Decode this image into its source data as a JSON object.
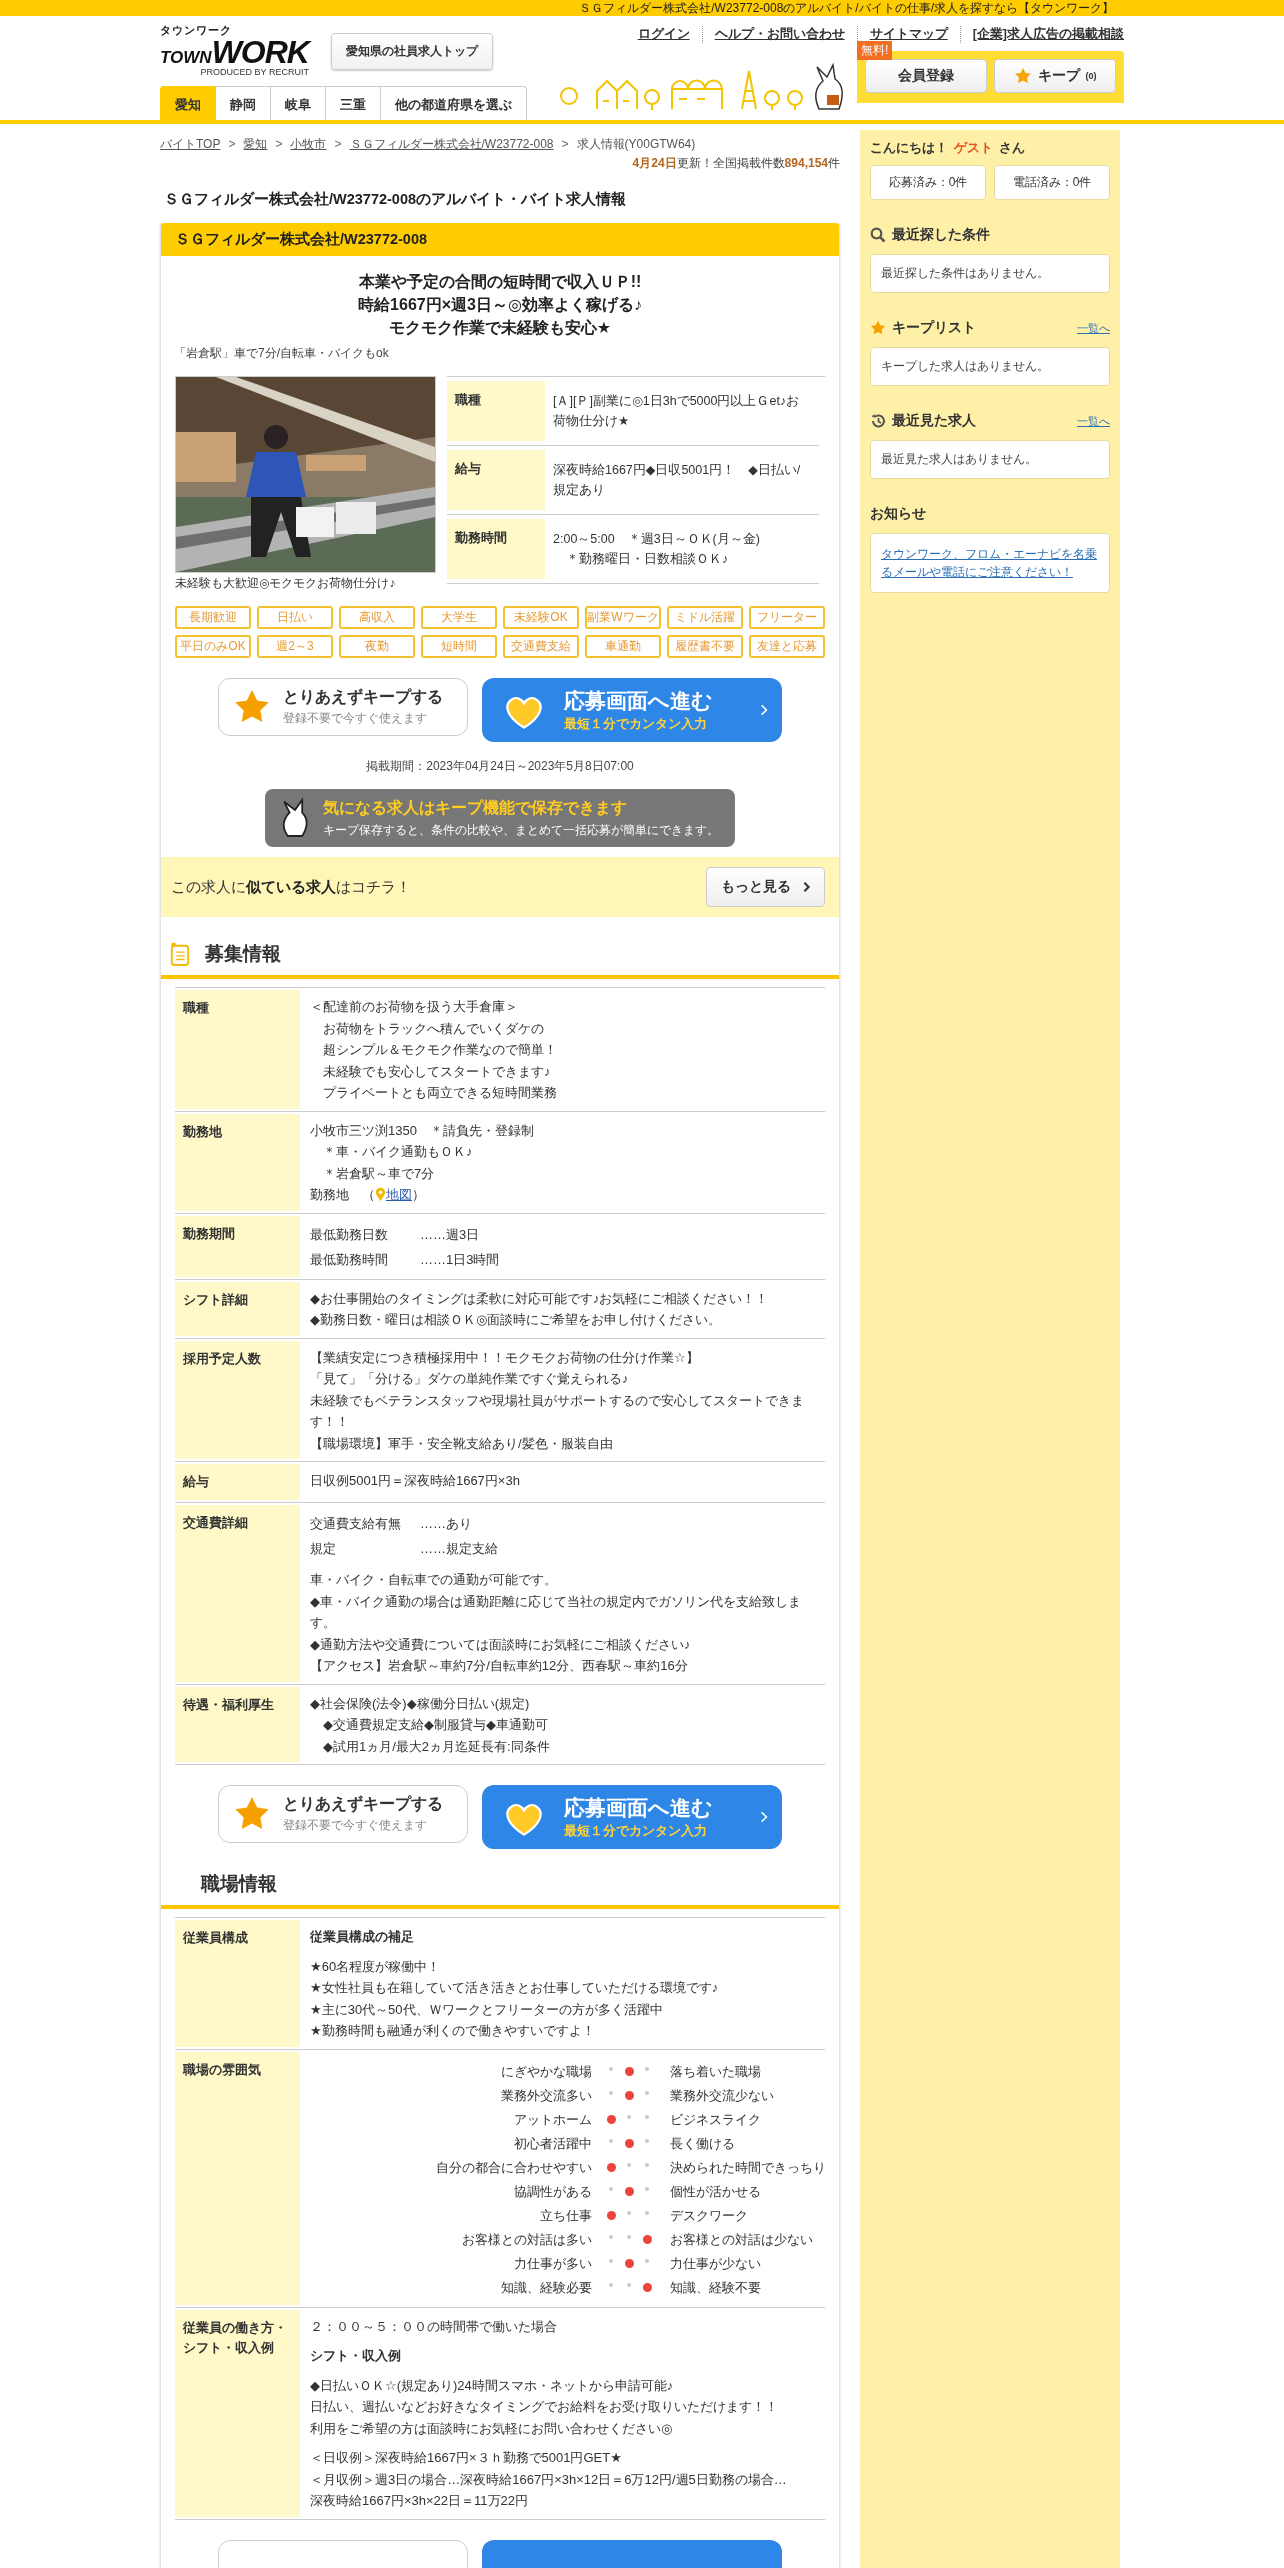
{
  "top_bar": {
    "text": "ＳＧフィルダー株式会社/W23772-008のアルバイト/バイトの仕事/求人を探すなら【タウンワーク】"
  },
  "header": {
    "logo": {
      "kana": "タウンワーク",
      "town": "TOWN",
      "work": "WORK",
      "sub": "PRODUCED BY RECRUIT"
    },
    "pref_top_button": "愛知県の社員求人トップ",
    "utility_links": [
      "ログイン",
      "ヘルプ・お問い合わせ",
      "サイトマップ",
      "[企業]求人広告の掲載相談"
    ],
    "pref_tabs": [
      {
        "label": "愛知",
        "selected": true
      },
      {
        "label": "静岡",
        "selected": false
      },
      {
        "label": "岐阜",
        "selected": false
      },
      {
        "label": "三重",
        "selected": false
      },
      {
        "label": "他の都道府県を選ぶ",
        "selected": false
      }
    ],
    "member_button": {
      "label": "会員登録",
      "badge": "無料!"
    },
    "keep_button": {
      "label": "キープ",
      "count": "(0)"
    }
  },
  "breadcrumb": [
    {
      "label": "バイトTOP",
      "link": true,
      "sep": ">"
    },
    {
      "label": "愛知",
      "link": true,
      "sep": ">"
    },
    {
      "label": "小牧市",
      "link": true,
      "sep": ">"
    },
    {
      "label": "ＳＧフィルダー株式会社/W23772-008",
      "link": true,
      "sep": ">"
    },
    {
      "label": "求人情報(Y00GTW64)",
      "link": false
    }
  ],
  "update": "**4月24日**更新！全国掲載件数**894,154**件",
  "page_title": "ＳＧフィルダー株式会社/W23772-008のアルバイト・バイト求人情報",
  "job": {
    "company": "ＳＧフィルダー株式会社/W23772-008",
    "catch": [
      "本業や予定の合間の短時間で収入ＵＰ!!",
      "時給1667円×週3日～◎効率よく稼げる♪",
      "モクモク作業で未経験も安心★"
    ],
    "access": "「岩倉駅」車で7分/自転車・バイクもok",
    "photo": {
      "kind": "picture",
      "caption": "未経験も大歓迎◎モクモクお荷物仕分け♪"
    },
    "summary": [
      {
        "label": "職種",
        "lines": [
          "[Ａ][Ｐ]副業に◎1日3hで5000円以上Ｇet♪お荷物仕分け★"
        ]
      },
      {
        "label": "給与",
        "lines": [
          "深夜時給1667円◆日収5001円！　◆日払い/規定あり"
        ]
      },
      {
        "label": "勤務時間",
        "lines": [
          "2:00～5:00　＊週3日～ＯＫ(月～金)",
          "　＊勤務曜日・日数相談ＯＫ♪"
        ]
      }
    ],
    "tags": [
      "長期歓迎",
      "日払い",
      "高収入",
      "大学生",
      "未経験OK",
      "副業Wワーク",
      "ミドル活躍",
      "フリーター",
      "平日のみOK",
      "週2～3",
      "夜勤",
      "短時間",
      "交通費支給",
      "車通勤",
      "履歴書不要",
      "友達と応募"
    ],
    "actions": {
      "keep_title": "とりあえずキープする",
      "keep_sub": "登録不要で今すぐ使えます",
      "apply_title": "応募画面へ進む",
      "apply_sub": "最短１分でカンタン入力"
    },
    "period": "掲載期間：2023年04月24日～2023年5月8日07:00",
    "keep_banner": {
      "title": "気になる求人はキープ機能で保存できます",
      "text": "キープ保存すると、条件の比較や、まとめて一括応募が簡単にできます。"
    },
    "similar": {
      "text": "この求人に**似ている求人**はコチラ！",
      "button": "もっと見る"
    }
  },
  "recruit": {
    "title": "募集情報",
    "rows": [
      {
        "label": "職種",
        "blocks": [
          {
            "kind": "text",
            "lines": [
              "＜配達前のお荷物を扱う大手倉庫＞",
              "　お荷物をトラックへ積んでいくダケの",
              "　超シンプル＆モクモク作業なので簡単！",
              "　未経験でも安心してスタートできます♪",
              "　プライベートとも両立できる短時間業務"
            ]
          }
        ]
      },
      {
        "label": "勤務地",
        "blocks": [
          {
            "kind": "text",
            "lines": [
              "小牧市三ツ渕1350　＊請負先・登録制",
              "　＊車・バイク通勤もＯＫ♪",
              "　＊岩倉駅～車で7分"
            ]
          },
          {
            "kind": "map",
            "prefix": "勤務地　（",
            "link": "地図",
            "suffix": "）"
          }
        ]
      },
      {
        "label": "勤務期間",
        "blocks": [
          {
            "kind": "pairs",
            "pairs": [
              {
                "key": "最低勤務日数",
                "value": "……週3日"
              },
              {
                "key": "最低勤務時間",
                "value": "……1日3時間"
              }
            ]
          }
        ]
      },
      {
        "label": "シフト詳細",
        "blocks": [
          {
            "kind": "text",
            "lines": [
              "◆お仕事開始のタイミングは柔軟に対応可能です♪お気軽にご相談ください！！",
              "◆勤務日数・曜日は相談ＯＫ◎面談時にご希望をお申し付けください。"
            ]
          }
        ]
      },
      {
        "label": "採用予定人数",
        "blocks": [
          {
            "kind": "text",
            "lines": [
              "【業績安定につき積極採用中！！モクモクお荷物の仕分け作業☆】",
              "「見て」「分ける」ダケの単純作業ですぐ覚えられる♪",
              "未経験でもベテランスタッフや現場社員がサポートするので安心してスタートできます！！",
              "【職場環境】軍手・安全靴支給あり/髪色・服装自由"
            ]
          }
        ]
      },
      {
        "label": "給与",
        "blocks": [
          {
            "kind": "text",
            "lines": [
              "日収例5001円＝深夜時給1667円×3h"
            ]
          }
        ]
      },
      {
        "label": "交通費詳細",
        "blocks": [
          {
            "kind": "pairs",
            "pairs": [
              {
                "key": "交通費支給有無",
                "value": "……あり"
              },
              {
                "key": "規定",
                "value": "……規定支給"
              }
            ]
          },
          {
            "kind": "text",
            "lines": [
              "車・バイク・自転車での通勤が可能です。",
              "◆車・バイク通勤の場合は通勤距離に応じて当社の規定内でガソリン代を支給致します。",
              "◆通勤方法や交通費については面談時にお気軽にご相談ください♪",
              "【アクセス】岩倉駅～車約7分/自転車約12分、西春駅～車約16分"
            ]
          }
        ]
      },
      {
        "label": "待遇・福利厚生",
        "blocks": [
          {
            "kind": "text",
            "lines": [
              "◆社会保険(法令)◆稼働分日払い(規定)",
              "　◆交通費規定支給◆制服貸与◆車通勤可",
              "　◆試用1ヵ月/最大2ヵ月迄延長有:同条件"
            ]
          }
        ]
      }
    ],
    "actions": {
      "keep_title": "とりあえずキープする",
      "keep_sub": "登録不要で今すぐ使えます",
      "apply_title": "応募画面へ進む",
      "apply_sub": "最短１分でカンタン入力"
    }
  },
  "workplace": {
    "title": "職場情報",
    "rows": [
      {
        "label": "従業員構成",
        "blocks": [
          {
            "kind": "heading",
            "text": "従業員構成の補足"
          },
          {
            "kind": "text",
            "lines": [
              "★60名程度が稼働中！",
              "★女性社員も在籍していて活き活きとお仕事していただける環境です♪",
              "★主に30代～50代、Ｗワークとフリーターの方が多く活躍中",
              "★勤務時間も融通が利くので働きやすいですよ！"
            ]
          }
        ]
      },
      {
        "label": "職場の雰囲気",
        "blocks": [
          {
            "kind": "scale",
            "items": [
              {
                "left": "にぎやかな職場",
                "right": "落ち着いた職場",
                "dots": [
                  {
                    "selected": false
                  },
                  {
                    "selected": true
                  },
                  {
                    "selected": false
                  }
                ]
              },
              {
                "left": "業務外交流多い",
                "right": "業務外交流少ない",
                "dots": [
                  {
                    "selected": false
                  },
                  {
                    "selected": true
                  },
                  {
                    "selected": false
                  }
                ]
              },
              {
                "left": "アットホーム",
                "right": "ビジネスライク",
                "dots": [
                  {
                    "selected": true
                  },
                  {
                    "selected": false
                  },
                  {
                    "selected": false
                  }
                ]
              },
              {
                "left": "初心者活躍中",
                "right": "長く働ける",
                "dots": [
                  {
                    "selected": false
                  },
                  {
                    "selected": true
                  },
                  {
                    "selected": false
                  }
                ]
              },
              {
                "left": "自分の都合に合わせやすい",
                "right": "決められた時間できっちり",
                "dots": [
                  {
                    "selected": true
                  },
                  {
                    "selected": false
                  },
                  {
                    "selected": false
                  }
                ]
              },
              {
                "left": "協調性がある",
                "right": "個性が活かせる",
                "dots": [
                  {
                    "selected": false
                  },
                  {
                    "selected": true
                  },
                  {
                    "selected": false
                  }
                ]
              },
              {
                "left": "立ち仕事",
                "right": "デスクワーク",
                "dots": [
                  {
                    "selected": true
                  },
                  {
                    "selected": false
                  },
                  {
                    "selected": false
                  }
                ]
              },
              {
                "left": "お客様との対話は多い",
                "right": "お客様との対話は少ない",
                "dots": [
                  {
                    "selected": false
                  },
                  {
                    "selected": false
                  },
                  {
                    "selected": true
                  }
                ]
              },
              {
                "left": "力仕事が多い",
                "right": "力仕事が少ない",
                "dots": [
                  {
                    "selected": false
                  },
                  {
                    "selected": true
                  },
                  {
                    "selected": false
                  }
                ]
              },
              {
                "left": "知識、経験必要",
                "right": "知識、経験不要",
                "dots": [
                  {
                    "selected": false
                  },
                  {
                    "selected": false
                  },
                  {
                    "selected": true
                  }
                ]
              }
            ]
          }
        ]
      },
      {
        "label": "従業員の働き方・シフト・収入例",
        "blocks": [
          {
            "kind": "text",
            "lines": [
              "２：００～５：００の時間帯で働いた場合"
            ]
          },
          {
            "kind": "heading",
            "text": "シフト・収入例"
          },
          {
            "kind": "text",
            "lines": [
              "◆日払いＯＫ☆(規定あり)24時間スマホ・ネットから申請可能♪",
              "日払い、週払いなどお好きなタイミングでお給料をお受け取りいただけます！！",
              "利用をご希望の方は面談時にお気軽にお問い合わせください◎"
            ]
          },
          {
            "kind": "text",
            "lines": [
              "＜日収例＞深夜時給1667円×３ｈ勤務で5001円GET★",
              "＜月収例＞週3日の場合…深夜時給1667円×3h×12日＝6万12円/週5日勤務の場合…",
              "深夜時給1667円×3h×22日＝11万22円"
            ]
          }
        ]
      }
    ]
  },
  "sidebar": {
    "greeting": {
      "prefix": "こんにちは！",
      "name": "ゲスト",
      "suffix": "さん"
    },
    "counts": [
      "応募済み：0件",
      "電話済み：0件"
    ],
    "sections": [
      {
        "kind": "search",
        "title": "最近探した条件",
        "empty": "最近探した条件はありません。"
      },
      {
        "kind": "keep",
        "title": "キープリスト",
        "link": "一覧へ",
        "empty": "キープした求人はありません。"
      },
      {
        "kind": "history",
        "title": "最近見た求人",
        "link": "一覧へ",
        "empty": "最近見た求人はありません。"
      },
      {
        "kind": "notice",
        "title": "お知らせ",
        "notice": "タウンワーク、フロム・エーナビを名乗るメールや電話にご注意ください！"
      }
    ]
  }
}
